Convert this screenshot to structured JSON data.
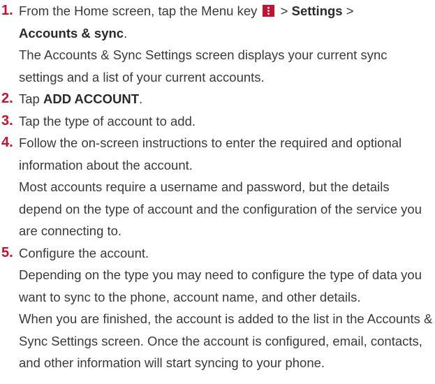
{
  "steps": [
    {
      "number": "1.",
      "line1_pre": "From the Home screen, tap the Menu key",
      "line1_sep1": " > ",
      "line1_bold1": "Settings",
      "line1_sep2": " >",
      "line2_bold": "Accounts & sync",
      "line2_post": ".",
      "sub": "The Accounts & Sync Settings screen displays your current sync settings and a list of your current accounts.",
      "icon": "menu-key-icon"
    },
    {
      "number": "2.",
      "pre": "Tap ",
      "bold": "ADD ACCOUNT",
      "post": "."
    },
    {
      "number": "3.",
      "text": "Tap the type of account to add."
    },
    {
      "number": "4.",
      "text": "Follow the on-screen instructions to enter the required and optional information about the account.",
      "sub": "Most accounts require a username and password, but the details depend on the type of account and the configuration of the service you are connecting to."
    },
    {
      "number": "5.",
      "text": "Configure the account.",
      "sub1": "Depending on the type you may need to configure the type of data you want to sync to the phone, account name, and other details.",
      "sub2": "When you are finished, the account is added to the list in the Accounts & Sync Settings screen. Once the account is configured, email, contacts, and other information will start syncing to your phone."
    }
  ],
  "colors": {
    "step_number": "#c8102e",
    "text": "#3a3a3a",
    "menu_key_bg": "#c8102e"
  }
}
